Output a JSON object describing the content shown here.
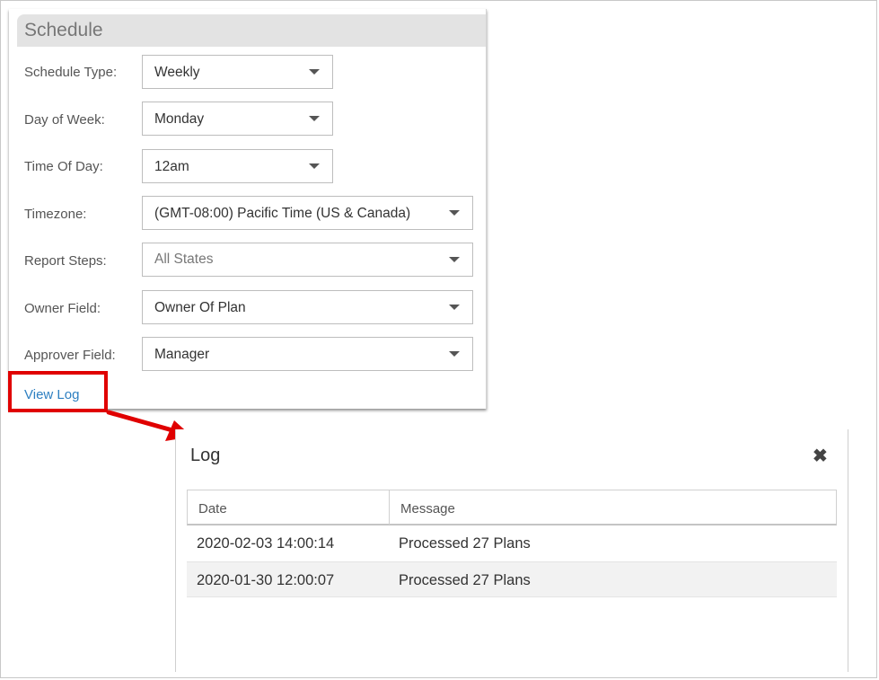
{
  "schedule": {
    "title": "Schedule",
    "fields": [
      {
        "label": "Schedule Type:",
        "value": "Weekly"
      },
      {
        "label": "Day of Week:",
        "value": "Monday"
      },
      {
        "label": "Time Of Day:",
        "value": "12am"
      },
      {
        "label": "Timezone:",
        "value": "(GMT-08:00) Pacific Time (US & Canada)"
      },
      {
        "label": "Report Steps:",
        "value": "All States"
      },
      {
        "label": "Owner Field:",
        "value": "Owner Of Plan"
      },
      {
        "label": "Approver Field:",
        "value": "Manager"
      }
    ],
    "view_log_link": "View Log"
  },
  "log_dialog": {
    "title": "Log",
    "close_icon": "close-icon",
    "columns": [
      "Date",
      "Message"
    ],
    "rows": [
      {
        "date": "2020-02-03 14:00:14",
        "message": "Processed 27 Plans"
      },
      {
        "date": "2020-01-30 12:00:07",
        "message": "Processed 27 Plans"
      }
    ]
  },
  "annotation": {
    "highlight_color": "#e00000",
    "arrow_color": "#e00000"
  },
  "colors": {
    "link": "#2d7fc1",
    "header_bg": "#e3e3e3",
    "alt_row_bg": "#f2f2f2"
  }
}
